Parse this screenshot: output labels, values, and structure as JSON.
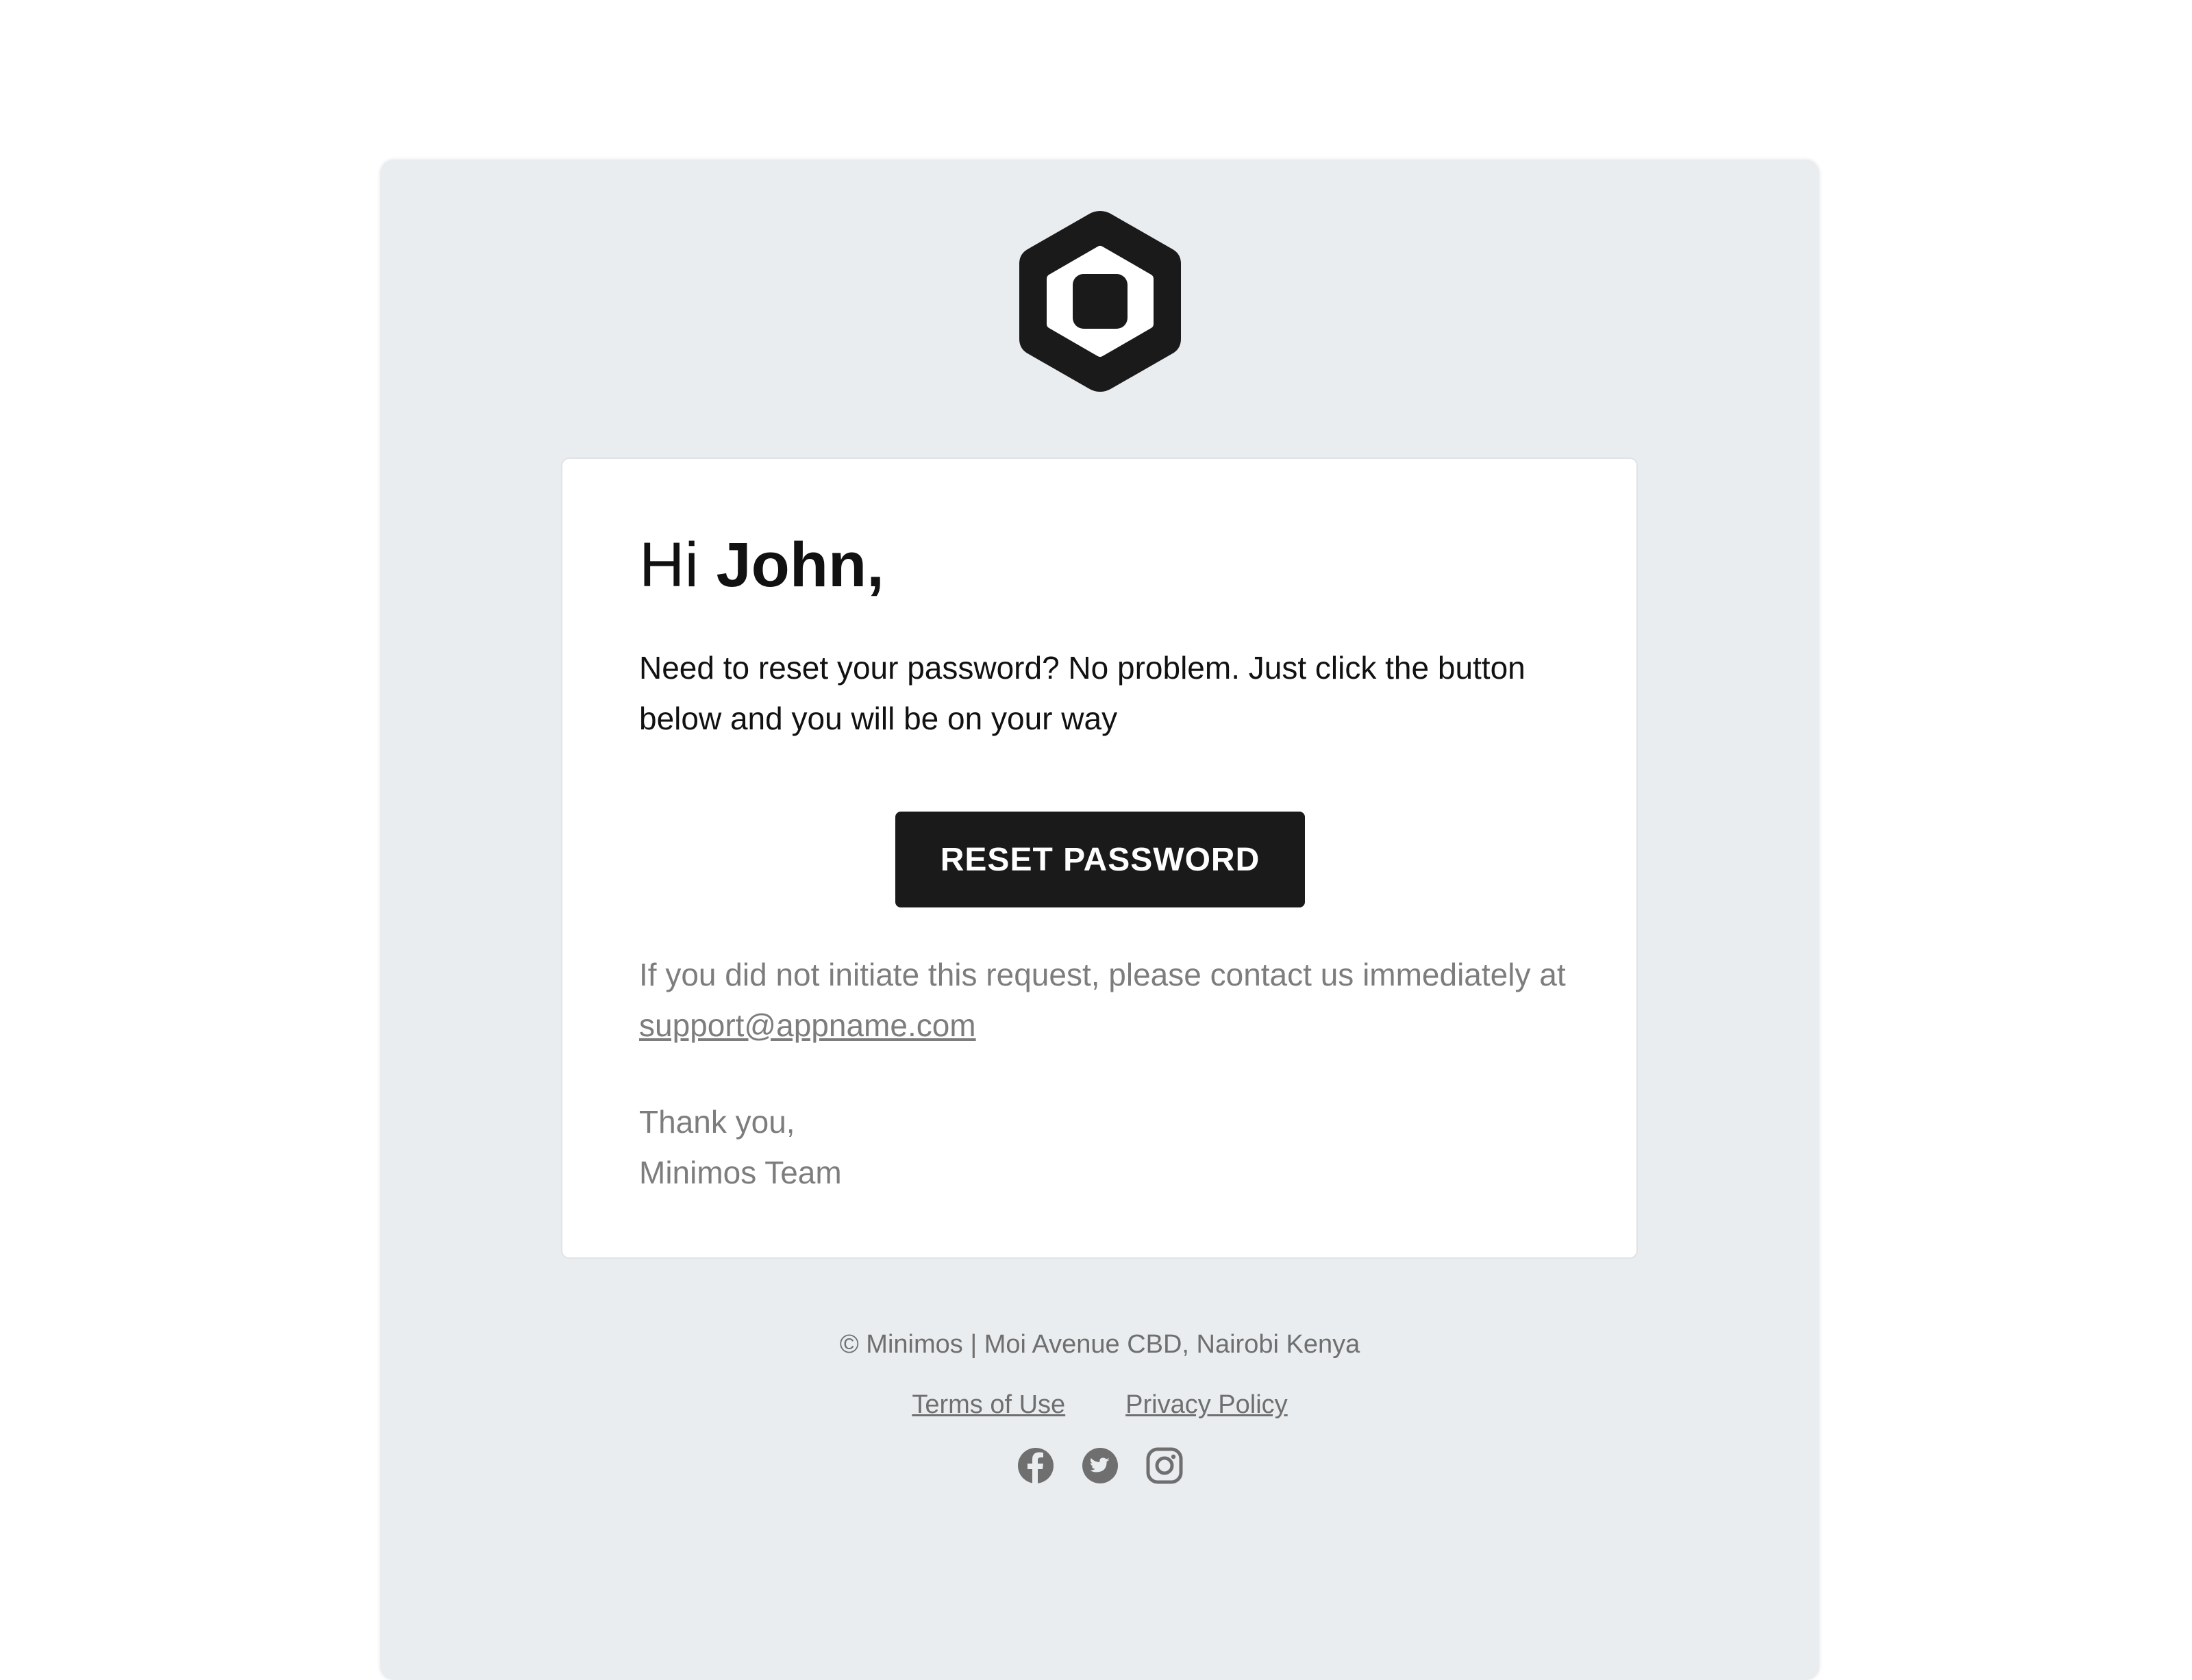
{
  "brand": {
    "logo_icon": "hexagon-logo-icon",
    "accent_color": "#1a1a1a",
    "shell_color": "#eaedf0"
  },
  "email": {
    "greeting_prefix": "Hi ",
    "greeting_name": "John,",
    "body": "Need to reset your password? No problem. Just click the button below and you will be on your way",
    "button_label": "RESET PASSWORD",
    "notice_text": "If you did not initiate this request, please contact us immediately at ",
    "support_email": "support@appname.com",
    "signoff_line1": "Thank you,",
    "signoff_line2": "Minimos Team"
  },
  "footer": {
    "address": "© Minimos | Moi Avenue CBD, Nairobi Kenya",
    "links": [
      {
        "label": "Terms of Use"
      },
      {
        "label": "Privacy Policy"
      }
    ],
    "socials": [
      {
        "icon": "facebook-icon"
      },
      {
        "icon": "twitter-icon"
      },
      {
        "icon": "instagram-icon"
      }
    ]
  }
}
